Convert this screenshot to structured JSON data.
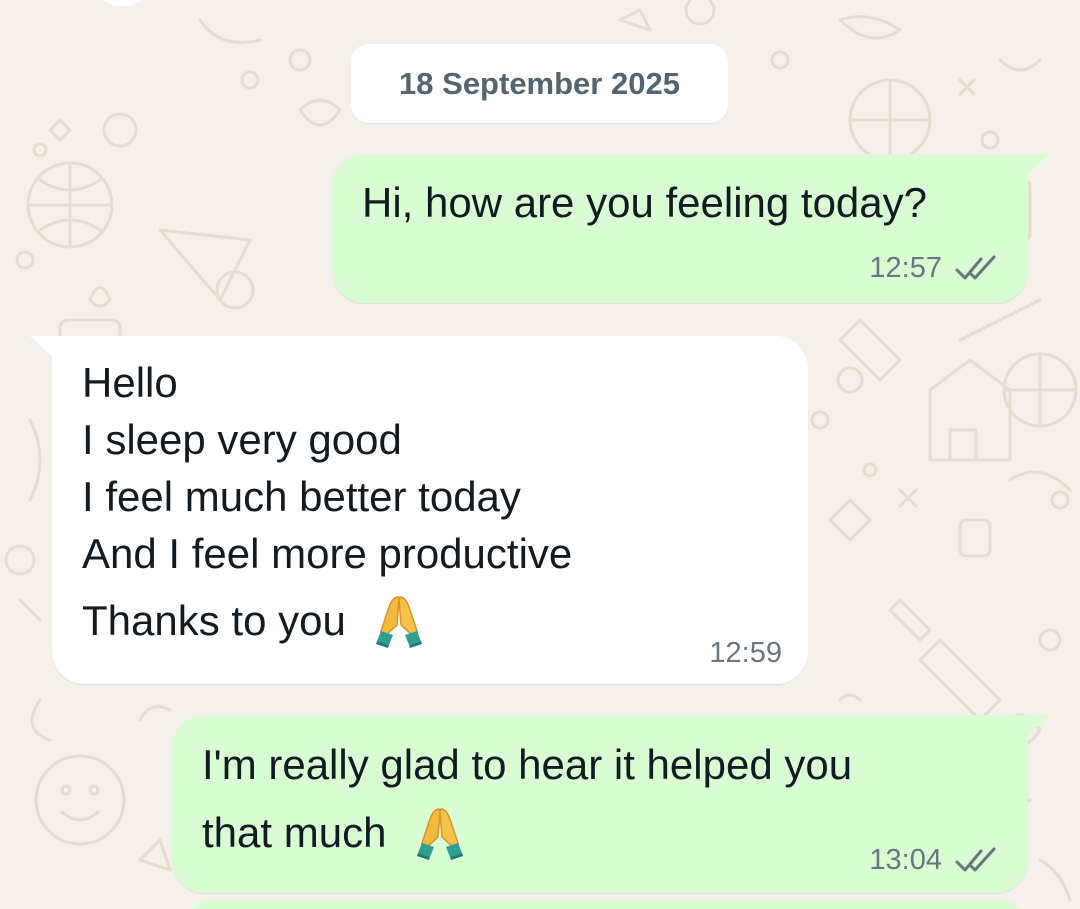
{
  "date_chip": "18 September 2025",
  "messages": [
    {
      "direction": "outgoing",
      "lines": [
        "Hi, how are you feeling today?"
      ],
      "time": "12:57",
      "status": "read-double-check"
    },
    {
      "direction": "incoming",
      "lines": [
        "Hello",
        "I sleep very good",
        "I feel much better today",
        "And I feel more productive",
        "Thanks to you"
      ],
      "emoji": "folded-hands",
      "time": "12:59"
    },
    {
      "direction": "outgoing",
      "lines": [
        "I'm really glad to hear it helped you",
        "that much"
      ],
      "emoji": "folded-hands",
      "time": "13:04",
      "status": "read-double-check"
    }
  ],
  "colors": {
    "wallpaper": "#f5f1ea",
    "outgoing_bubble": "#d9fdd3",
    "incoming_bubble": "#ffffff",
    "meta_text": "#667781",
    "message_text": "#111b21"
  }
}
